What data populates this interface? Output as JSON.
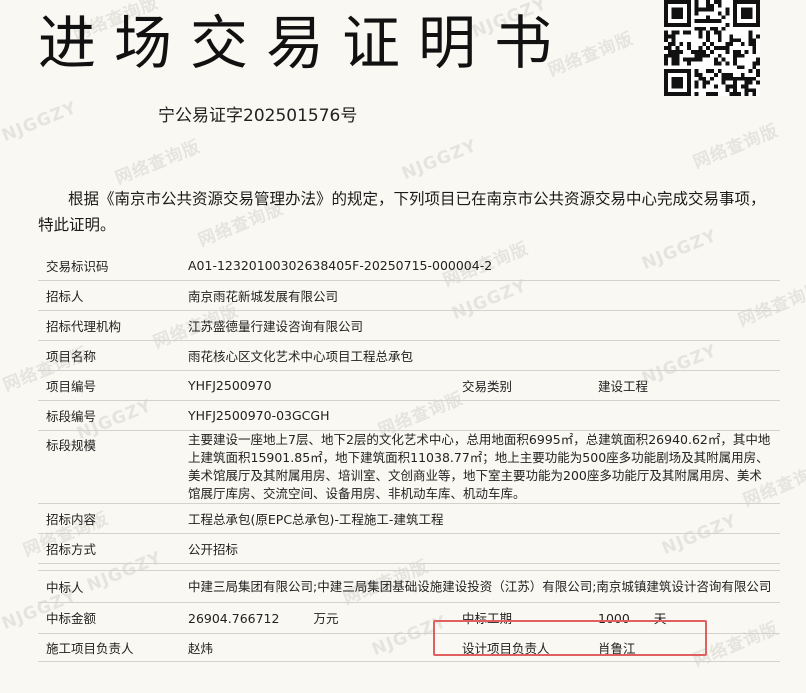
{
  "header": {
    "title": "进场交易证明书",
    "doc_number": "宁公易证字202501576号"
  },
  "intro": "根据《南京市公共资源交易管理办法》的规定，下列项目已在南京市公共资源交易中心完成交易事项，特此证明。",
  "watermark": {
    "text_a": "NJGGZY",
    "text_b": "网络查询版"
  },
  "fields": {
    "trade_id_label": "交易标识码",
    "trade_id": "A01-12320100302638405F-20250715-000004-2",
    "tenderer_label": "招标人",
    "tenderer": "南京雨花新城发展有限公司",
    "agent_label": "招标代理机构",
    "agent": "江苏盛德量行建设咨询有限公司",
    "project_name_label": "项目名称",
    "project_name": "雨花核心区文化艺术中心项目工程总承包",
    "project_no_label": "项目编号",
    "project_no": "YHFJ2500970",
    "trade_type_label": "交易类别",
    "trade_type": "建设工程",
    "section_no_label": "标段编号",
    "section_no": "YHFJ2500970-03GCGH",
    "scale_label": "标段规模",
    "scale": "主要建设一座地上7层、地下2层的文化艺术中心，总用地面积6995㎡，总建筑面积26940.62㎡，其中地上建筑面积15901.85㎡，地下建筑面积11038.77㎡；地上主要功能为500座多功能剧场及其附属用房、美术馆展厅及其附属用房、培训室、文创商业等，地下室主要功能为200座多功能厅及其附属用房、美术馆展厅库房、交流空间、设备用房、非机动车库、机动车库。",
    "content_label": "招标内容",
    "content": "工程总承包(原EPC总承包)-工程施工-建筑工程",
    "method_label": "招标方式",
    "method": "公开招标",
    "winner_label": "中标人",
    "winner": "中建三局集团有限公司;中建三局集团基础设施建设投资（江苏）有限公司;南京城镇建筑设计咨询有限公司",
    "amount_label": "中标金额",
    "amount": "26904.766712",
    "amount_unit": "万元",
    "period_label": "中标工期",
    "period": "1000",
    "period_unit": "天",
    "construction_mgr_label": "施工项目负责人",
    "construction_mgr": "赵炜",
    "design_mgr_label": "设计项目负责人",
    "design_mgr": "肖鲁江"
  },
  "colors": {
    "highlight_border": "#e06060",
    "row_line": "#d4d2cc",
    "background": "#faf8f2"
  }
}
